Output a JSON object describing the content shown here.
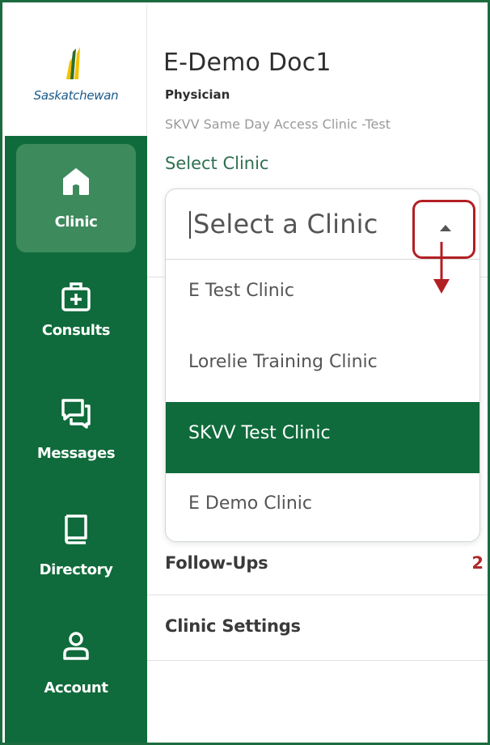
{
  "sidebar": {
    "logo_text": "Saskatchewan",
    "items": [
      {
        "label": "Clinic",
        "icon": "home-icon",
        "active": true
      },
      {
        "label": "Consults",
        "icon": "medical-kit-icon",
        "active": false
      },
      {
        "label": "Messages",
        "icon": "chat-icon",
        "active": false
      },
      {
        "label": "Directory",
        "icon": "book-icon",
        "active": false
      },
      {
        "label": "Account",
        "icon": "user-icon",
        "active": false
      }
    ]
  },
  "user": {
    "name": "E-Demo Doc1",
    "role": "Physician",
    "clinic": "SKVV Same Day Access Clinic -Test"
  },
  "clinic_select": {
    "label": "Select Clinic",
    "placeholder": "Select a Clinic",
    "options": [
      "E Test Clinic",
      "Lorelie Training Clinic",
      "SKVV Test Clinic",
      "E Demo Clinic"
    ],
    "highlighted": "SKVV Test Clinic"
  },
  "menu": {
    "follow_ups": "Follow-Ups",
    "follow_ups_count": "2",
    "clinic_settings": "Clinic Settings"
  },
  "colors": {
    "brand_green": "#0f6b3b",
    "active_green": "#3d8a5d",
    "annotation_red": "#b21f24"
  }
}
